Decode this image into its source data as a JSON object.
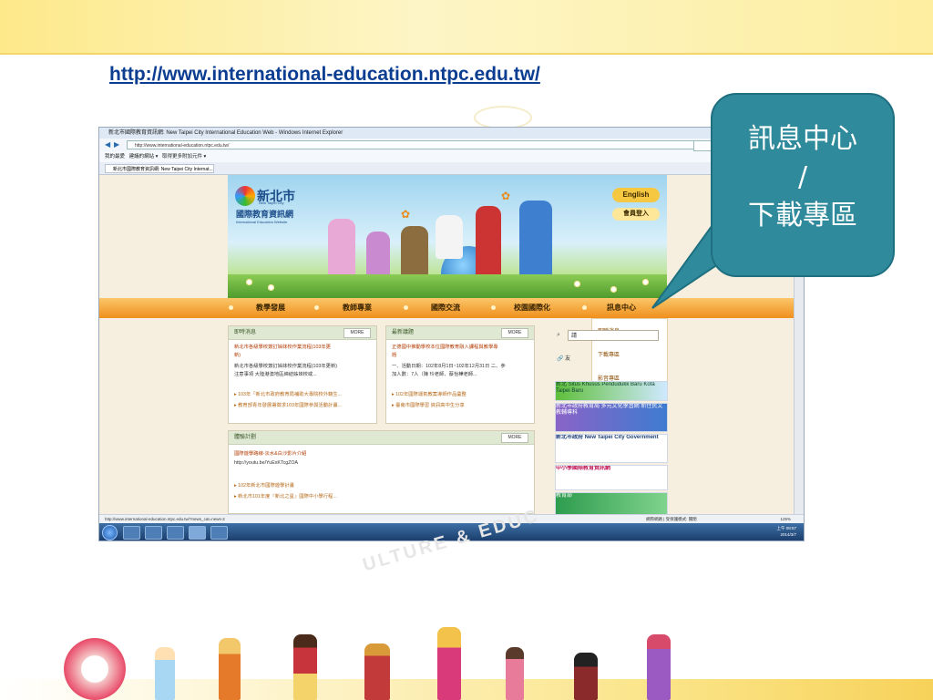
{
  "slide": {
    "url": "http://www.international-education.ntpc.edu.tw/",
    "callout": [
      "訊息中心",
      "/",
      "下載專區"
    ],
    "watermark": "ULTURE & EDUC"
  },
  "browser": {
    "title": "新北市國際教育資訊網: New Taipei City International Education Web - Windows Internet Explorer",
    "address": "http://www.international-education.ntpc.edu.tw/",
    "favorites_bar": [
      "我的最愛",
      "建議的網站 ▾",
      "取得更多附加元件 ▾"
    ],
    "tab_label": "新北市國際教育資訊網: New Taipei City Internat...",
    "status_url": "http://www.international-education.ntpc.edu.tw/?news_cat=news-2",
    "status_right": "網際網路 | 受保護模式: 關閉",
    "zoom": "125%",
    "clock_time": "上午 08:57",
    "clock_date": "2014/3/7"
  },
  "site": {
    "logo_title": "新北市",
    "logo_sub": "國際教育資訊網",
    "logo_en": "International Education Website",
    "logo_en2": "New Taipei City",
    "english_button": "English",
    "login_button": "會員登入",
    "nav": [
      "教學發展",
      "教師專業",
      "國際交流",
      "校園國際化",
      "訊息中心"
    ],
    "dropdown": [
      "即時消息",
      "下載專區",
      "影音專區"
    ],
    "news_panel": {
      "title": "即時消息",
      "more": "MORE",
      "lines": [
        "新北市各級學校簽訂姊妹校作業流程(103年更",
        "新)",
        "新北市各級學校簽訂姊妹校作業流程(103年更新)",
        "注意事項 大陸港澳地區締結姊妹校或...",
        "▸ 103年「新北市政府教育局補助大專院校外籍生...",
        "▸ 教育部青年發展署徵求103年國際參與活動計畫..."
      ]
    },
    "topic_panel": {
      "title": "最新議題",
      "more": "MORE",
      "lines": [
        "正德國中推動學校本位國際教育融入課程與教學專",
        "題",
        "一、活動日期：102年8月1日~102年12月31日 二、參",
        "加人數：7人（陳 玲老師、蔡怡樺老師...",
        "▸ 102年國際運氣教案導師作品彙整",
        "▸ 臺南市國際學習 資訊高中生分享"
      ]
    },
    "exp_panel": {
      "title": "體驗計劃",
      "more": "MORE",
      "lines": [
        "國際遊學路線-淡水&白沙影片介紹",
        "http://youtu.be/YuExKTcgZOA",
        "▸ 102年新北市國際遊學計畫",
        "▸ 新北市101年度『新北之星』國際中小學行程..."
      ]
    },
    "side_search": "請",
    "side_fav": "友",
    "side_banners": [
      "新北 Situs Khusus Pendudukk Baru Kota Taipei Baru",
      "新北市政府教育局 多元文化學習網 新住民文教輔導科",
      "新北市政府 New Taipei City Government",
      "中小學國際教育資訊網",
      "教育部"
    ]
  },
  "colors": {
    "slide_band": "#fde98a",
    "url": "#0b3d91",
    "callout_bg": "#2f8a9b",
    "nav_orange": "#f08f1c"
  }
}
